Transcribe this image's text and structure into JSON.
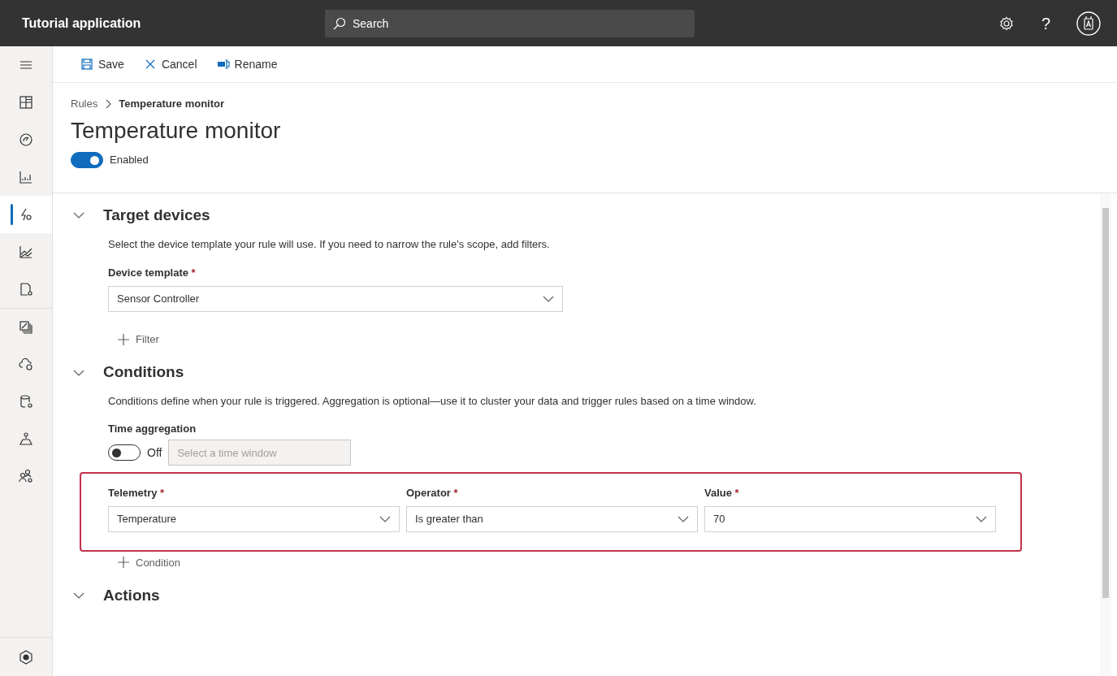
{
  "app_bar": {
    "title": "Tutorial application",
    "search": {
      "placeholder": "Search"
    },
    "help": "?"
  },
  "sidebar": {
    "items": [
      {
        "selected": false
      },
      {
        "selected": false
      },
      {
        "selected": false
      },
      {
        "selected": false
      },
      {
        "selected": true
      },
      {
        "selected": false
      },
      {
        "selected": false
      },
      {
        "selected": false
      },
      {
        "selected": false
      },
      {
        "selected": false
      },
      {
        "selected": false
      },
      {
        "selected": false
      },
      {
        "selected": false
      }
    ]
  },
  "toolbar": [
    "Save",
    "Cancel",
    "Rename"
  ],
  "breadcrumb": [
    "Rules",
    "Temperature monitor"
  ],
  "title": "Temperature monitor",
  "enabled_toggle": {
    "label": "Enabled",
    "on": true
  },
  "sections": [
    {
      "heading": "Target devices",
      "expanded": true,
      "description": "Select the device template your rule will use. If you need to narrow the rule's scope, add filters.",
      "fields": [
        {
          "label": "Device template",
          "required_mark": "*",
          "value": "Sensor Controller"
        }
      ],
      "add_label": "Filter"
    },
    {
      "heading": "Conditions",
      "expanded": true,
      "description": "Conditions define when your rule is triggered. Aggregation is optional—use it to cluster your data and trigger rules based on a time window.",
      "time_aggregation": {
        "label": "Time aggregation",
        "on": false,
        "state_label": "Off",
        "placeholder": "Select a time window"
      },
      "condition_fields": [
        {
          "label": "Telemetry",
          "required_mark": "*",
          "value": "Temperature"
        },
        {
          "label": "Operator",
          "required_mark": "*",
          "value": "Is greater than"
        },
        {
          "label": "Value",
          "required_mark": "*",
          "value": "70"
        }
      ],
      "add_label": "Condition"
    },
    {
      "heading": "Actions",
      "expanded": true
    }
  ]
}
